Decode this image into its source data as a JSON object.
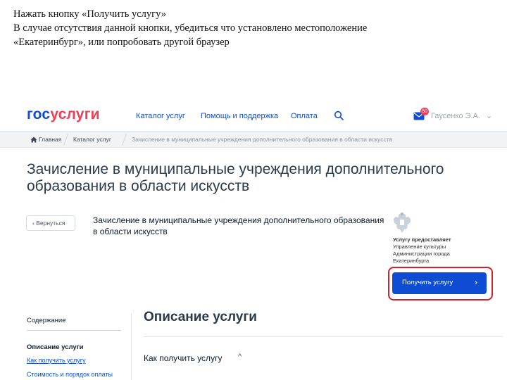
{
  "instructions": {
    "line1": "Нажать кнопку «Получить услугу»",
    "line2": "В случае отсутствия данной кнопки, убедиться что установлено местоположение",
    "line3": "«Екатеринбург», или попробовать другой браузер"
  },
  "header": {
    "logo_part1": "гос",
    "logo_part2": "услуги",
    "nav": [
      "Каталог услуг",
      "Помощь и поддержка",
      "Оплата"
    ],
    "search_icon": "search-icon",
    "mail_badge": "50",
    "user_name": "Гаусенко Э.А."
  },
  "breadcrumbs": {
    "items": [
      "Главная",
      "Каталог услуг",
      "Зачисление в муниципальные учреждения дополнительного образования в области искусств"
    ]
  },
  "page_title": "Зачисление в муниципальные учреждения дополнительного образования в области искусств",
  "back_button": "‹  Вернуться",
  "service_title": "Зачисление в муниципальные учреждения дополнительного образования в области искусств",
  "provider": {
    "heading": "Услугу предоставляет",
    "name": "Управление культуры Администрации города Екатеринбурга"
  },
  "get_service_button": {
    "label": "Получить услугу",
    "chevron": "›"
  },
  "sidebar": {
    "heading": "Содержание",
    "active": "Описание услуги",
    "link": "Как получить услугу",
    "link_cut": "Стоимость и порядок оплаты"
  },
  "main": {
    "section_title": "Описание услуги",
    "subsection_title": "Как получить услугу",
    "subsection_chevron": "^"
  },
  "colors": {
    "brand_blue": "#0d4cd3",
    "brand_red": "#ee3f58",
    "highlight_red": "#d0232e"
  }
}
